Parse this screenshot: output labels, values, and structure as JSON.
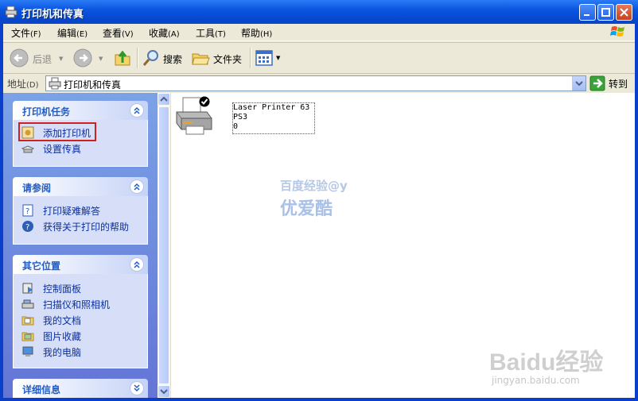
{
  "window": {
    "title": "打印机和传真"
  },
  "menubar": [
    {
      "label": "文件",
      "key": "(F)"
    },
    {
      "label": "编辑",
      "key": "(E)"
    },
    {
      "label": "查看",
      "key": "(V)"
    },
    {
      "label": "收藏",
      "key": "(A)"
    },
    {
      "label": "工具",
      "key": "(T)"
    },
    {
      "label": "帮助",
      "key": "(H)"
    }
  ],
  "toolbar": {
    "back_label": "后退",
    "search_label": "搜索",
    "folders_label": "文件夹"
  },
  "address": {
    "label": "地址",
    "key": "(D)",
    "value": "打印机和传真",
    "go_label": "转到"
  },
  "tasks_panel": {
    "title": "打印机任务",
    "items": [
      {
        "label": "添加打印机",
        "icon": "add-printer-icon"
      },
      {
        "label": "设置传真",
        "icon": "fax-icon"
      }
    ]
  },
  "see_also_panel": {
    "title": "请参阅",
    "items": [
      {
        "label": "打印疑难解答",
        "icon": "help-book-icon"
      },
      {
        "label": "获得关于打印的帮助",
        "icon": "help-icon"
      }
    ]
  },
  "other_places_panel": {
    "title": "其它位置",
    "items": [
      {
        "label": "控制面板",
        "icon": "control-panel-icon"
      },
      {
        "label": "扫描仪和照相机",
        "icon": "scanner-icon"
      },
      {
        "label": "我的文档",
        "icon": "my-documents-icon"
      },
      {
        "label": "图片收藏",
        "icon": "my-pictures-icon"
      },
      {
        "label": "我的电脑",
        "icon": "my-computer-icon"
      }
    ]
  },
  "details_panel": {
    "title": "详细信息"
  },
  "printers": [
    {
      "line1": "Laser Printer 63",
      "line2": "PS3",
      "line3": "0",
      "default": true
    }
  ],
  "watermarks": {
    "line1": "百度经验@y",
    "line2": "优爱酷",
    "baidu": "Baidu经验",
    "url": "jingyan.baidu.com"
  },
  "colors": {
    "titlebar": "#0a55e0",
    "pane_gradient_top": "#7ba2e7",
    "link": "#0c2f9c",
    "highlight_box": "#d02020"
  }
}
